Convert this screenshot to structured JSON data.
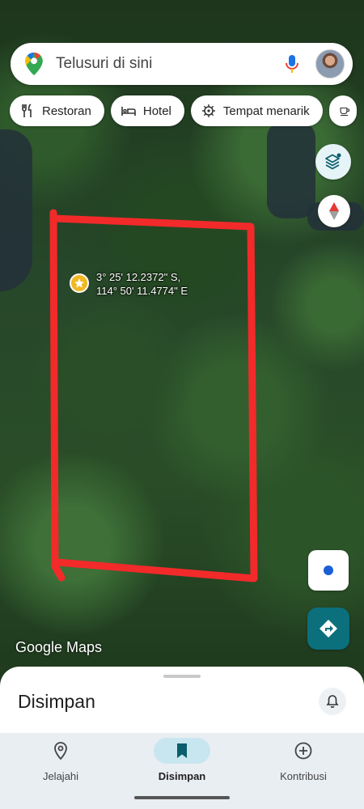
{
  "search": {
    "placeholder": "Telusuri di sini"
  },
  "chips": [
    {
      "label": "Restoran",
      "icon": "fork-knife-icon"
    },
    {
      "label": "Hotel",
      "icon": "bed-icon"
    },
    {
      "label": "Tempat menarik",
      "icon": "attraction-icon"
    },
    {
      "label": "",
      "icon": "coffee-icon"
    }
  ],
  "map": {
    "coordinates": {
      "line1": "3° 25' 12.2372\" S,",
      "line2": "114° 50' 11.4774\" E"
    },
    "watermark": "Google Maps",
    "annotation_color": "#f22a2a"
  },
  "sheet": {
    "title": "Disimpan"
  },
  "nav": {
    "items": [
      {
        "label": "Jelajahi",
        "icon": "location-pin-icon",
        "active": false
      },
      {
        "label": "Disimpan",
        "icon": "bookmark-icon",
        "active": true
      },
      {
        "label": "Kontribusi",
        "icon": "add-circle-icon",
        "active": false
      }
    ]
  },
  "colors": {
    "accent_teal": "#0b6f7c",
    "location_blue": "#1a5fd6",
    "star_yellow": "#f2b824"
  }
}
